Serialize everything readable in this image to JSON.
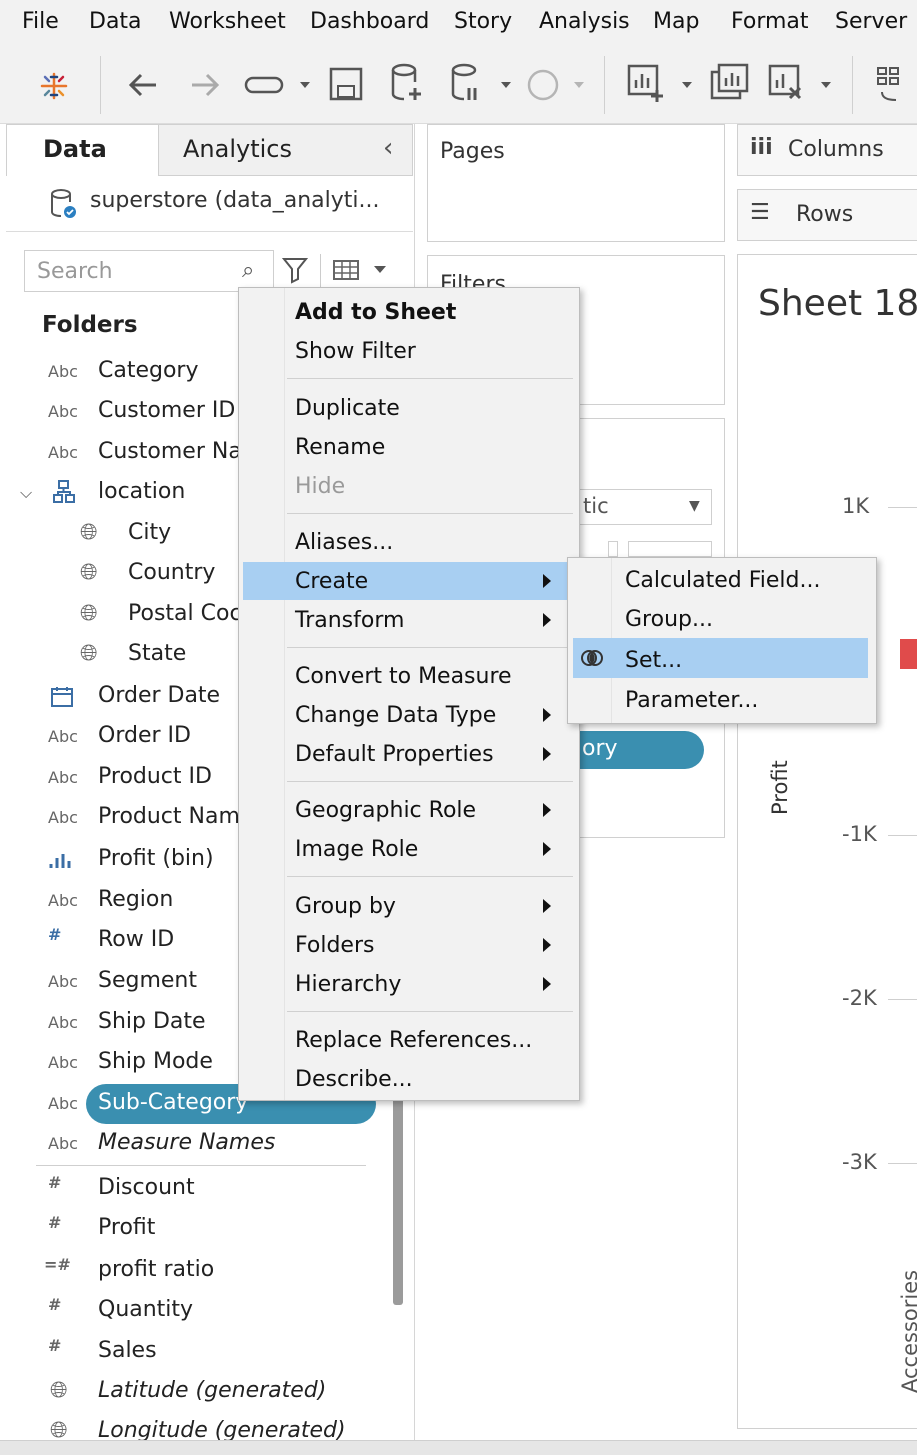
{
  "menubar": {
    "file": "File",
    "data": "Data",
    "worksheet": "Worksheet",
    "dashboard": "Dashboard",
    "story": "Story",
    "analysis": "Analysis",
    "map": "Map",
    "format": "Format",
    "server": "Server"
  },
  "sidepane": {
    "tab_data": "Data",
    "tab_analytics": "Analytics",
    "datasource": "superstore (data_analyti...",
    "search_placeholder": "Search",
    "folders_title": "Folders",
    "fields": {
      "category": "Category",
      "customer_id": "Customer ID",
      "customer_name": "Customer Na",
      "location": "location",
      "city": "City",
      "country": "Country",
      "postal_code": "Postal Coc",
      "state": "State",
      "order_date": "Order Date",
      "order_id": "Order ID",
      "product_id": "Product ID",
      "product_name": "Product Nam",
      "profit_bin": "Profit (bin)",
      "region": "Region",
      "row_id": "Row ID",
      "segment": "Segment",
      "ship_date": "Ship Date",
      "ship_mode": "Ship Mode",
      "sub_category": "Sub-Category",
      "measure_names": "Measure Names",
      "discount": "Discount",
      "profit": "Profit",
      "profit_ratio": "profit ratio",
      "quantity": "Quantity",
      "sales": "Sales",
      "latitude": "Latitude (generated)",
      "longitude": "Longitude (generated)"
    },
    "abc": "Abc"
  },
  "shelves": {
    "pages": "Pages",
    "filters": "Filters",
    "marks_dropdown": "tic",
    "marks_pill": "ory",
    "columns": "Columns",
    "rows": "Rows"
  },
  "sheet": {
    "title": "Sheet 18",
    "y_axis_label": "Profit",
    "y_ticks": [
      "1K",
      "-1K",
      "-2K",
      "-3K"
    ],
    "x_category": "Accessories"
  },
  "context_menu": {
    "add_to_sheet": "Add to Sheet",
    "show_filter": "Show Filter",
    "duplicate": "Duplicate",
    "rename": "Rename",
    "hide": "Hide",
    "aliases": "Aliases...",
    "create": "Create",
    "transform": "Transform",
    "convert_to_measure": "Convert to Measure",
    "change_data_type": "Change Data Type",
    "default_properties": "Default Properties",
    "geographic_role": "Geographic Role",
    "image_role": "Image Role",
    "group_by": "Group by",
    "folders": "Folders",
    "hierarchy": "Hierarchy",
    "replace_references": "Replace References...",
    "describe": "Describe..."
  },
  "submenu": {
    "calculated_field": "Calculated Field...",
    "group": "Group...",
    "set": "Set...",
    "parameter": "Parameter..."
  },
  "colors": {
    "highlight": "#a8cff2",
    "pill": "#3a8fb0",
    "dimension_icon": "#4a4a4a",
    "measure_icon": "#1f9e77",
    "mark_red": "#e04b4b"
  }
}
